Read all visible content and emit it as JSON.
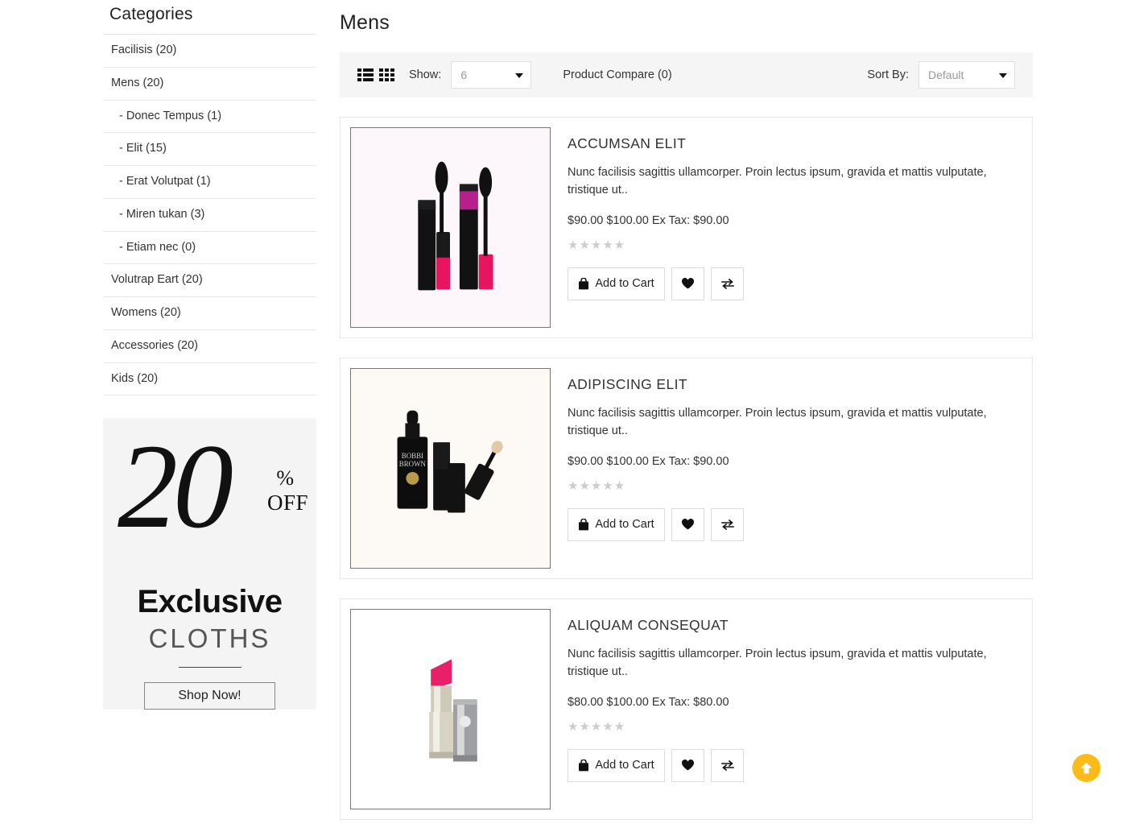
{
  "sidebar": {
    "title": "Categories",
    "categories": [
      {
        "label": "Facilisis (20)",
        "child": false
      },
      {
        "label": "Mens (20)",
        "child": false
      },
      {
        "label": "- Donec Tempus (1)",
        "child": true
      },
      {
        "label": "- Elit (15)",
        "child": true
      },
      {
        "label": "- Erat Volutpat (1)",
        "child": true
      },
      {
        "label": "- Miren tukan (3)",
        "child": true
      },
      {
        "label": "- Etiam nec (0)",
        "child": true
      },
      {
        "label": "Volutrap Eart (20)",
        "child": false
      },
      {
        "label": "Womens (20)",
        "child": false
      },
      {
        "label": "Accessories (20)",
        "child": false
      },
      {
        "label": "Kids (20)",
        "child": false
      }
    ],
    "promo": {
      "number": "20",
      "percent": "%",
      "off": "OFF",
      "line1": "Exclusive",
      "line2": "CLOTHS",
      "button": "Shop Now!"
    }
  },
  "main": {
    "page_title": "Mens",
    "toolbar": {
      "list_view_icon": "list-view-icon",
      "grid_view_icon": "grid-view-icon",
      "show_label": "Show:",
      "show_value": "6",
      "compare_label": "Product Compare (0)",
      "sort_label": "Sort By:",
      "sort_value": "Default"
    },
    "product_buttons": {
      "cart": "Add to Cart",
      "wishlist_icon": "heart-icon",
      "compare_icon": "compare-arrows-icon"
    },
    "products": [
      {
        "title": "ACCUMSAN ELIT",
        "description": "Nunc facilisis sagittis ullamcorper. Proin lectus ipsum, gravida et mattis vulputate, tristique ut..",
        "price": "$90.00",
        "old_price": "$100.00",
        "tax": "Ex Tax: $90.00",
        "rating": 0,
        "image": "mascara-duo"
      },
      {
        "title": "ADIPISCING ELIT",
        "description": "Nunc facilisis sagittis ullamcorper. Proin lectus ipsum, gravida et mattis vulputate, tristique ut..",
        "price": "$90.00",
        "old_price": "$100.00",
        "tax": "Ex Tax: $90.00",
        "rating": 0,
        "image": "serum-set"
      },
      {
        "title": "ALIQUAM CONSEQUAT",
        "description": "Nunc facilisis sagittis ullamcorper. Proin lectus ipsum, gravida et mattis vulputate, tristique ut..",
        "price": "$80.00",
        "old_price": "$100.00",
        "tax": "Ex Tax: $80.00",
        "rating": 0,
        "image": "pink-lipstick"
      }
    ]
  },
  "scroll_top": {
    "icon": "arrow-up-icon"
  },
  "colors": {
    "scroll_top_bg": "#fcbb18",
    "toolbar_bg": "#f5f5f5",
    "promo_bg": "#f4f4f4",
    "star_empty": "#cccccc",
    "border": "#e6e6e6"
  }
}
